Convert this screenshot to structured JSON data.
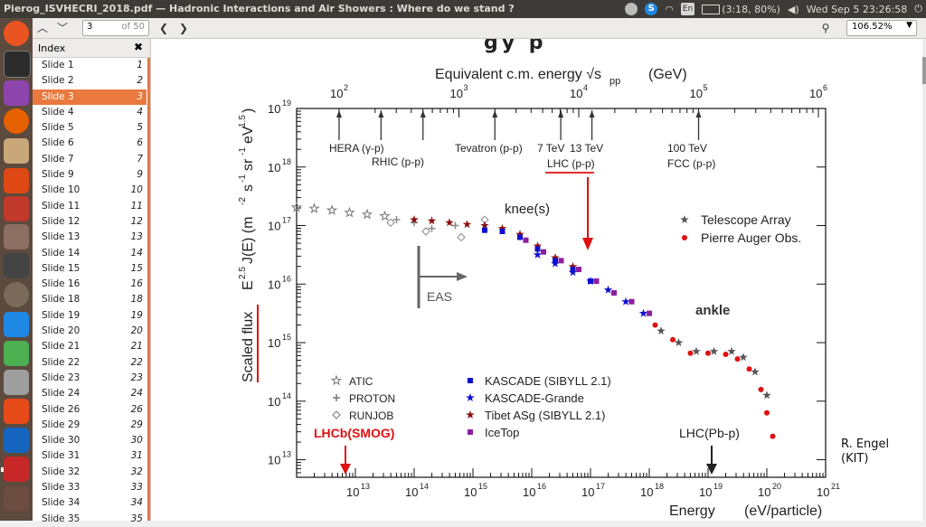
{
  "window_title": "Pierog_ISVHECRI_2018.pdf — Hadronic Interactions and Air Showers : Where do we stand ?",
  "tray": {
    "skype_letter": "S",
    "keyboard": "En",
    "battery": "(3:18, 80%)",
    "clock": "Wed Sep  5 23:26:58"
  },
  "toolbar": {
    "page_current": "3",
    "page_total": "of 50",
    "zoom": "106.52%"
  },
  "sidebar": {
    "header": "Index",
    "items": [
      {
        "label": "Slide 1",
        "page": "1"
      },
      {
        "label": "Slide 2",
        "page": "2"
      },
      {
        "label": "Slide 3",
        "page": "3"
      },
      {
        "label": "Slide 4",
        "page": "4"
      },
      {
        "label": "Slide 5",
        "page": "5"
      },
      {
        "label": "Slide 6",
        "page": "6"
      },
      {
        "label": "Slide 7",
        "page": "7"
      },
      {
        "label": "Slide 9",
        "page": "9"
      },
      {
        "label": "Slide 10",
        "page": "10"
      },
      {
        "label": "Slide 11",
        "page": "11"
      },
      {
        "label": "Slide 12",
        "page": "12"
      },
      {
        "label": "Slide 13",
        "page": "13"
      },
      {
        "label": "Slide 14",
        "page": "14"
      },
      {
        "label": "Slide 15",
        "page": "15"
      },
      {
        "label": "Slide 16",
        "page": "16"
      },
      {
        "label": "Slide 18",
        "page": "18"
      },
      {
        "label": "Slide 19",
        "page": "19"
      },
      {
        "label": "Slide 20",
        "page": "20"
      },
      {
        "label": "Slide 21",
        "page": "21"
      },
      {
        "label": "Slide 22",
        "page": "22"
      },
      {
        "label": "Slide 23",
        "page": "23"
      },
      {
        "label": "Slide 24",
        "page": "24"
      },
      {
        "label": "Slide 26",
        "page": "26"
      },
      {
        "label": "Slide 29",
        "page": "29"
      },
      {
        "label": "Slide 30",
        "page": "30"
      },
      {
        "label": "Slide 31",
        "page": "31"
      },
      {
        "label": "Slide 32",
        "page": "32"
      },
      {
        "label": "Slide 33",
        "page": "33"
      },
      {
        "label": "Slide 34",
        "page": "34"
      },
      {
        "label": "Slide 35",
        "page": "35"
      }
    ],
    "selected_index": 2
  },
  "slide": {
    "title_fragment": "gy  p",
    "credit_line1": "R.  Engel",
    "credit_line2": "(KIT)"
  },
  "chart_data": {
    "type": "scatter",
    "top_axis_label": "Equivalent c.m. energy  √s",
    "top_axis_sub": "pp",
    "top_axis_unit": "(GeV)",
    "top_ticks": [
      "10",
      "10",
      "10",
      "10",
      "10"
    ],
    "top_tick_exps": [
      "2",
      "3",
      "4",
      "5",
      "6"
    ],
    "y_tick_exps": [
      "19",
      "18",
      "17",
      "16",
      "15",
      "14",
      "13"
    ],
    "y_ticks": [
      "10",
      "10",
      "10",
      "10",
      "10",
      "10",
      "10"
    ],
    "x_tick_exps": [
      "13",
      "14",
      "15",
      "16",
      "17",
      "18",
      "19",
      "20",
      "21"
    ],
    "x_ticks": [
      "10",
      "10",
      "10",
      "10",
      "10",
      "10",
      "10",
      "10",
      "10"
    ],
    "xlabel": "Energy",
    "xunit": "(eV/particle)",
    "ylabel_main": "Scaled flux",
    "ylabel_formula": "E",
    "ylabel_sup": "2.5",
    "ylabel_rest": " J(E)  (m",
    "ylabel_units_sup": "-2",
    "ylabel_units": "s",
    "ylabel_units_sup2": "-1",
    "ylabel_units2": "sr",
    "ylabel_units_sup3": "-1",
    "ylabel_units3": "eV",
    "ylabel_units_sup4": "1.5",
    "ylabel_close": ")",
    "ylim_log10": [
      12.7,
      19.0
    ],
    "xlim_log10": [
      12.0,
      21.0
    ],
    "accelerator_markers": [
      {
        "label": "HERA (γ-p)",
        "log_sqrt_s": 2.0
      },
      {
        "label": "RHIC (p-p)",
        "log_sqrt_s": 2.35
      },
      {
        "label": "",
        "log_sqrt_s": 2.7
      },
      {
        "label": "Tevatron (p-p)",
        "log_sqrt_s": 3.3
      },
      {
        "label": "7 TeV",
        "log_sqrt_s": 3.85
      },
      {
        "label": "13 TeV",
        "log_sqrt_s": 4.11
      },
      {
        "label": "100 TeV",
        "log_sqrt_s": 5.0
      }
    ],
    "lhc_label": "LHC (p-p)",
    "fcc_label": "FCC (p-p)",
    "annotations": {
      "knee": "knee(s)",
      "ankle": "ankle",
      "eas": "EAS",
      "lhcb": "LHCb(SMOG)",
      "lhc_pb": "LHC(Pb-p)"
    },
    "legend_right": [
      {
        "name": "Telescope Array",
        "color": "#555555",
        "marker": "star"
      },
      {
        "name": "Pierre Auger Obs.",
        "color": "#e01010",
        "marker": "circle"
      }
    ],
    "legend_left": [
      {
        "name": "ATIC",
        "marker": "star-open"
      },
      {
        "name": "PROTON",
        "marker": "cross-open"
      },
      {
        "name": "RUNJOB",
        "marker": "diamond-open"
      }
    ],
    "legend_mid": [
      {
        "name": "KASCADE (SIBYLL 2.1)",
        "color": "#1010d0",
        "marker": "square"
      },
      {
        "name": "KASCADE-Grande",
        "color": "#1010d0",
        "marker": "star"
      },
      {
        "name": "Tibet ASg (SIBYLL 2.1)",
        "color": "#8b1010",
        "marker": "star"
      },
      {
        "name": "IceTop",
        "color": "#8a1fa0",
        "marker": "square"
      }
    ],
    "series": [
      {
        "name": "ATIC",
        "color": "#888888",
        "x": [
          12.0,
          12.3,
          12.6,
          12.9,
          13.2,
          13.5
        ],
        "y": [
          17.31,
          17.29,
          17.26,
          17.22,
          17.19,
          17.16
        ]
      },
      {
        "name": "PROTON",
        "color": "#888888",
        "x": [
          13.7,
          14.0,
          14.3,
          14.7
        ],
        "y": [
          17.1,
          17.05,
          16.95,
          17.0
        ]
      },
      {
        "name": "RUNJOB",
        "color": "#888888",
        "x": [
          13.6,
          14.2,
          14.8,
          15.2
        ],
        "y": [
          17.05,
          16.9,
          16.8,
          17.1
        ]
      },
      {
        "name": "Tibet ASg (SIBYLL 2.1)",
        "color": "#8b1010",
        "x": [
          14.0,
          14.3,
          14.6,
          14.9,
          15.2,
          15.5,
          15.8,
          16.1,
          16.4,
          16.7
        ],
        "y": [
          17.1,
          17.08,
          17.05,
          17.02,
          17.0,
          16.95,
          16.85,
          16.65,
          16.45,
          16.3
        ]
      },
      {
        "name": "KASCADE (SIBYLL 2.1)",
        "color": "#1010d0",
        "x": [
          15.2,
          15.5,
          15.8,
          16.1,
          16.4,
          16.7,
          17.0
        ],
        "y": [
          16.92,
          16.9,
          16.8,
          16.6,
          16.4,
          16.25,
          16.05
        ]
      },
      {
        "name": "KASCADE-Grande",
        "color": "#1010d0",
        "x": [
          16.1,
          16.4,
          16.7,
          17.0,
          17.3,
          17.6,
          17.9
        ],
        "y": [
          16.5,
          16.35,
          16.2,
          16.05,
          15.9,
          15.7,
          15.5
        ]
      },
      {
        "name": "IceTop",
        "color": "#8a1fa0",
        "x": [
          15.9,
          16.2,
          16.5,
          16.8,
          17.1,
          17.4,
          17.7,
          18.0
        ],
        "y": [
          16.75,
          16.55,
          16.4,
          16.25,
          16.05,
          15.85,
          15.7,
          15.5
        ]
      },
      {
        "name": "Telescope Array",
        "color": "#555555",
        "x": [
          18.2,
          18.5,
          18.8,
          19.1,
          19.4,
          19.6,
          19.8,
          20.0
        ],
        "y": [
          15.2,
          15.0,
          14.85,
          14.85,
          14.85,
          14.75,
          14.5,
          14.1
        ]
      },
      {
        "name": "Pierre Auger Obs.",
        "color": "#e01010",
        "x": [
          18.1,
          18.4,
          18.7,
          19.0,
          19.3,
          19.5,
          19.7,
          19.9,
          20.0,
          20.1
        ],
        "y": [
          15.3,
          15.05,
          14.82,
          14.82,
          14.8,
          14.72,
          14.55,
          14.2,
          13.8,
          13.4
        ]
      }
    ]
  }
}
